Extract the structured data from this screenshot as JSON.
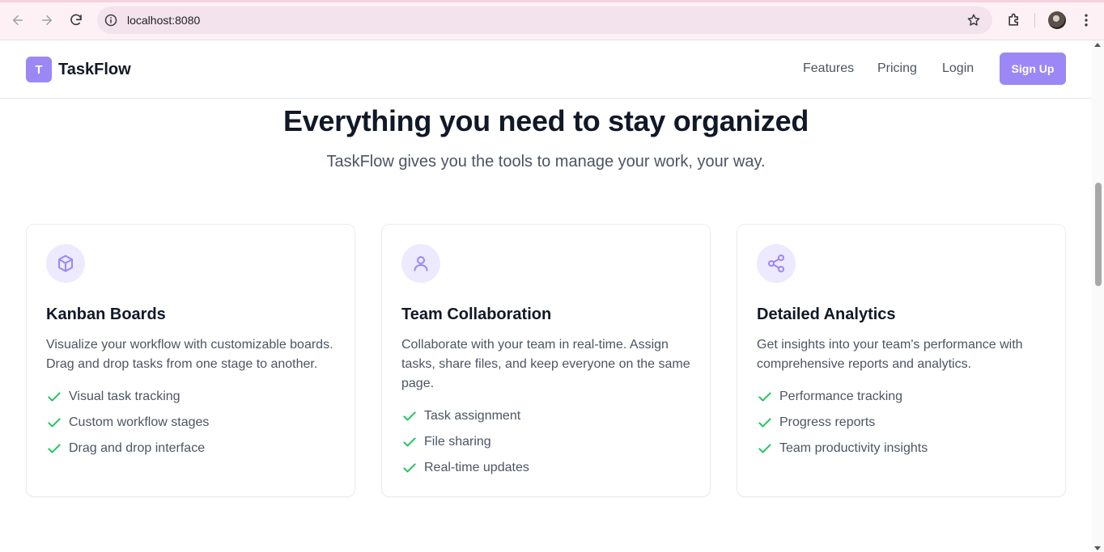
{
  "browser": {
    "url": "localhost:8080"
  },
  "site": {
    "logo_letter": "T",
    "brand": "TaskFlow",
    "nav": {
      "features": "Features",
      "pricing": "Pricing",
      "login": "Login",
      "signup": "Sign Up"
    }
  },
  "hero": {
    "title": "Everything you need to stay organized",
    "subtitle": "TaskFlow gives you the tools to manage your work, your way."
  },
  "cards": [
    {
      "icon": "cube-icon",
      "title": "Kanban Boards",
      "description": "Visualize your workflow with customizable boards. Drag and drop tasks from one stage to another.",
      "features": [
        "Visual task tracking",
        "Custom workflow stages",
        "Drag and drop interface"
      ]
    },
    {
      "icon": "user-icon",
      "title": "Team Collaboration",
      "description": "Collaborate with your team in real-time. Assign tasks, share files, and keep everyone on the same page.",
      "features": [
        "Task assignment",
        "File sharing",
        "Real-time updates"
      ]
    },
    {
      "icon": "share-icon",
      "title": "Detailed Analytics",
      "description": "Get insights into your team's performance with comprehensive reports and analytics.",
      "features": [
        "Performance tracking",
        "Progress reports",
        "Team productivity insights"
      ]
    }
  ],
  "colors": {
    "accent": "#9b87f5",
    "icon_bg": "#ede9fe",
    "check": "#22c55e",
    "heading": "#111827",
    "body_text": "#4b5563"
  }
}
